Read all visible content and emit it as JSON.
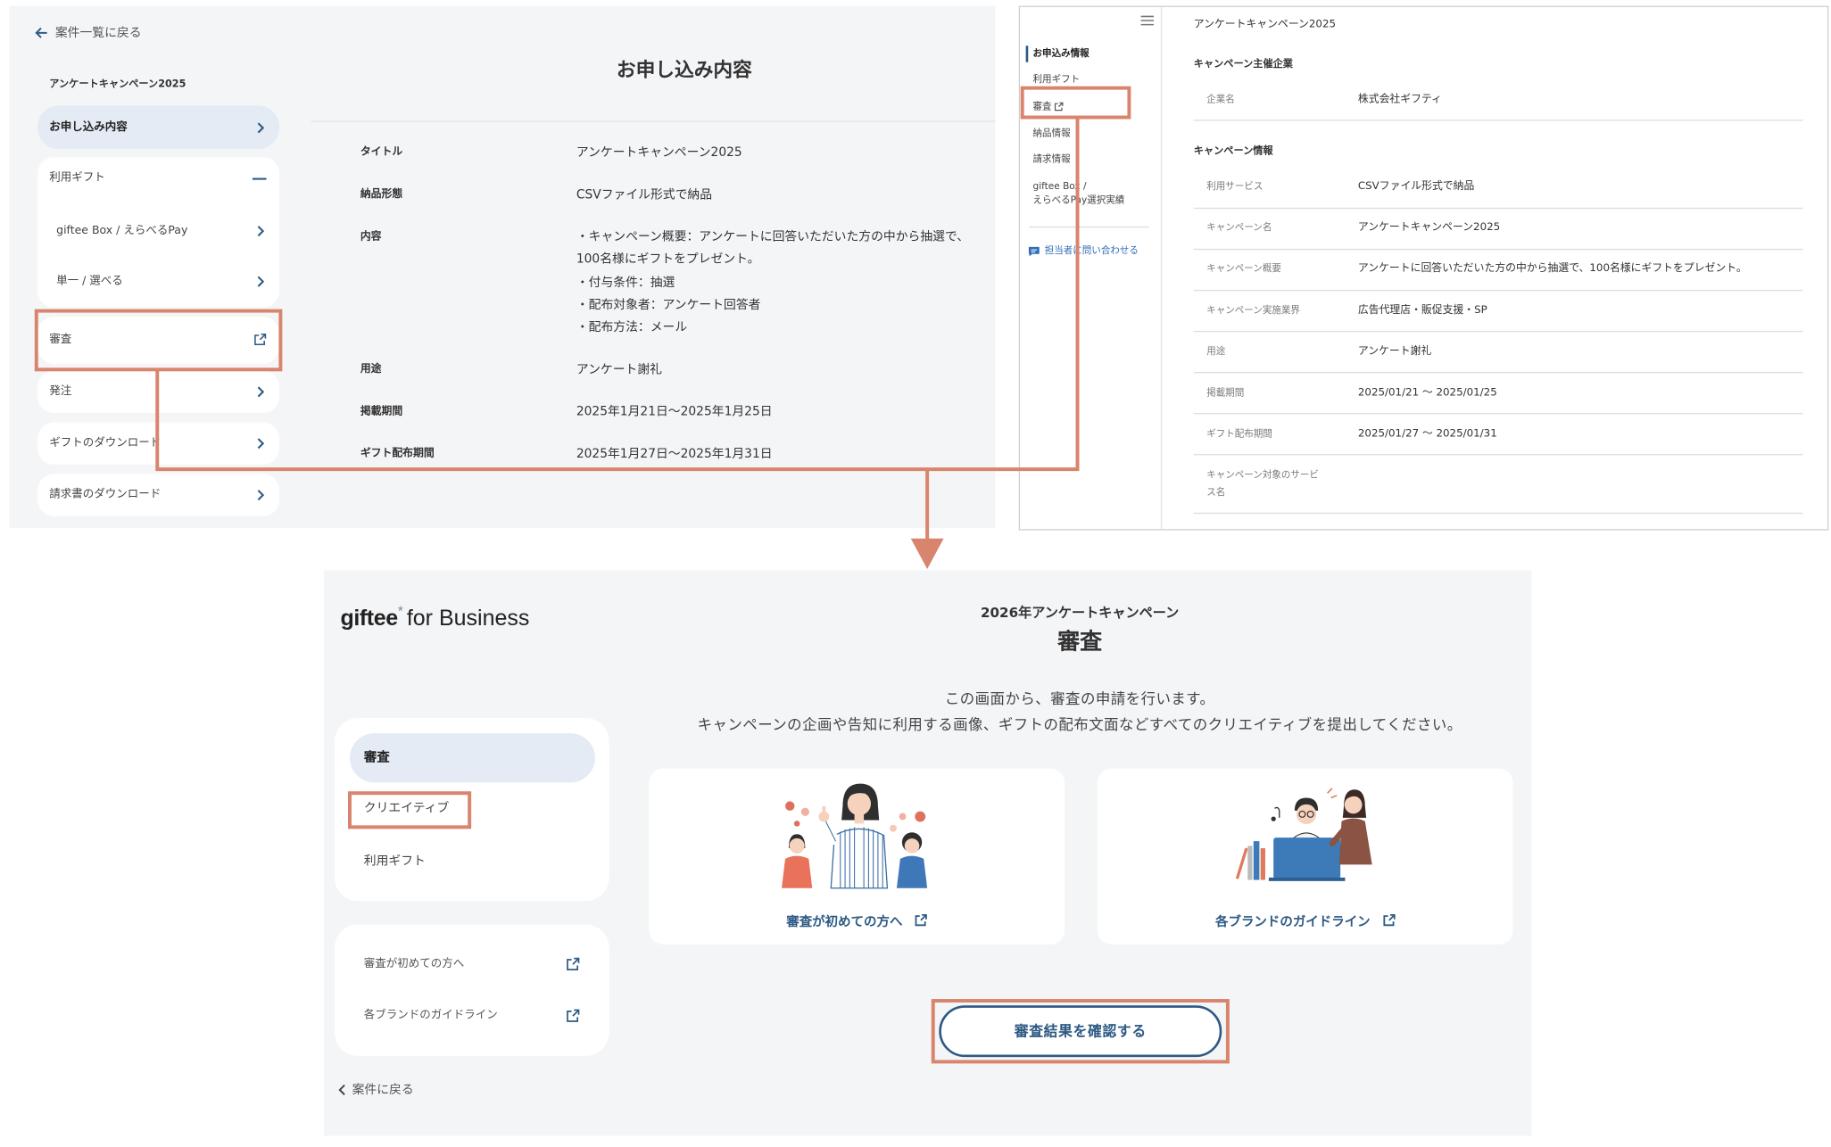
{
  "application_panel": {
    "back_link": "案件一覧に戻る",
    "campaign_name": "アンケートキャンペーン2025",
    "sidebar": {
      "application": "お申し込み内容",
      "gifts": "利用ギフト",
      "gift_items": [
        "giftee Box / えらべるPay",
        "単一 / 選べる"
      ],
      "review": "審査",
      "order": "発注",
      "gift_download": "ギフトのダウンロード",
      "invoice_download": "請求書のダウンロード"
    },
    "title": "お申し込み内容",
    "rows": [
      {
        "label": "タイトル",
        "value": "アンケートキャンペーン2025"
      },
      {
        "label": "納品形態",
        "value": "CSVファイル形式で納品"
      },
      {
        "label": "内容",
        "value_lines": [
          "・キャンペーン概要：アンケートに回答いただいた方の中から抽選で、",
          "100名様にギフトをプレゼント。",
          "・付与条件：抽選",
          "・配布対象者：アンケート回答者",
          "・配布方法：メール"
        ]
      },
      {
        "label": "用途",
        "value": "アンケート謝礼"
      },
      {
        "label": "掲載期間",
        "value": "2025年1月21日〜2025年1月25日"
      },
      {
        "label": "ギフト配布期間",
        "value": "2025年1月27日〜2025年1月31日"
      }
    ]
  },
  "admin_panel": {
    "nav": {
      "items": [
        "お申込み情報",
        "利用ギフト",
        "審査",
        "納品情報",
        "請求情報"
      ],
      "gift_record_lines": [
        "giftee Box /",
        "えらべるPay選択実績"
      ],
      "contact": "担当者に問い合わせる"
    },
    "campaign_name": "アンケートキャンペーン2025",
    "sponsor_section": "キャンペーン主催企業",
    "sponsor_rows": [
      {
        "label": "企業名",
        "value": "株式会社ギフティ"
      }
    ],
    "campaign_section": "キャンペーン情報",
    "campaign_rows": [
      {
        "label": "利用サービス",
        "value": "CSVファイル形式で納品"
      },
      {
        "label": "キャンペーン名",
        "value": "アンケートキャンペーン2025"
      },
      {
        "label": "キャンペーン概要",
        "value": "アンケートに回答いただいた方の中から抽選で、100名様にギフトをプレゼント。"
      },
      {
        "label": "キャンペーン実施業界",
        "value": "広告代理店・販促支援・SP"
      },
      {
        "label": "用途",
        "value": "アンケート謝礼"
      },
      {
        "label": "掲載期間",
        "value": "2025/01/21 ～ 2025/01/25"
      },
      {
        "label": "ギフト配布期間",
        "value": "2025/01/27 ～ 2025/01/31"
      }
    ],
    "last_row_label_lines": [
      "キャンペーン対象のサービ",
      "ス名"
    ]
  },
  "review_panel": {
    "logo": {
      "brand": "giftee",
      "mark": "*",
      "suffix": "for Business"
    },
    "campaign_name": "2026年アンケートキャンペーン",
    "title": "審査",
    "description_lines": [
      "この画面から、審査の申請を行います。",
      "キャンペーンの企画や告知に利用する画像、ギフトの配布文面などすべてのクリエイティブを提出してください。"
    ],
    "nav": {
      "items": [
        "審査",
        "クリエイティブ",
        "利用ギフト"
      ],
      "links": [
        "審査が初めての方へ",
        "各ブランドのガイドライン"
      ]
    },
    "back_link": "案件に戻る",
    "cards": [
      {
        "label": "審査が初めての方へ",
        "illustration": "people-illustration"
      },
      {
        "label": "各ブランドのガイドライン",
        "illustration": "laptop-meeting-illustration"
      }
    ],
    "check_button": "審査結果を確認する"
  },
  "colors": {
    "highlight_orange": "#d9846c",
    "link_blue": "#2d5a84",
    "contact_blue": "#2e6db5",
    "active_bg": "#e4ebf4",
    "panel_bg": "#f4f5f7"
  }
}
